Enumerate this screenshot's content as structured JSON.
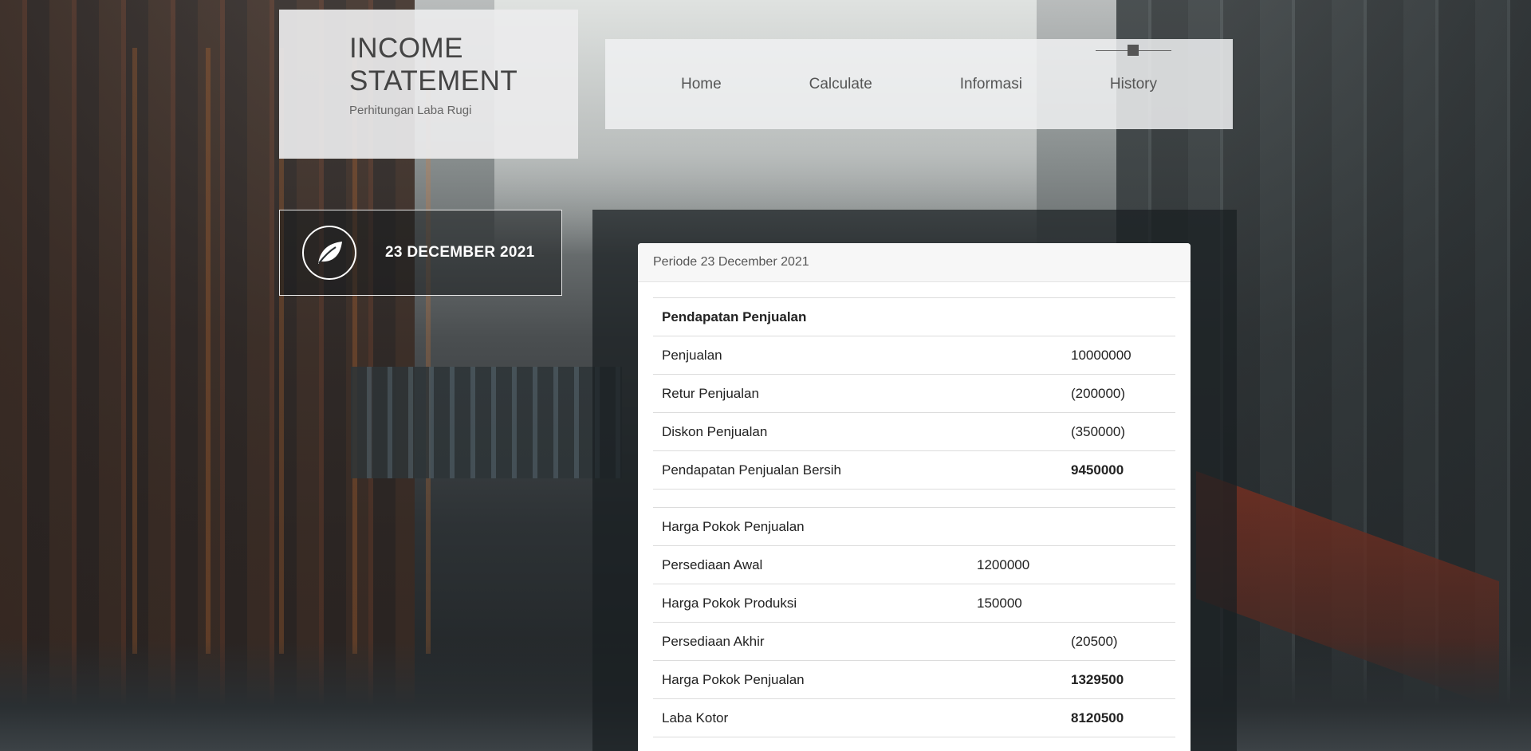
{
  "brand": {
    "title_line1": "INCOME",
    "title_line2": "STATEMENT",
    "subtitle": "Perhitungan Laba Rugi"
  },
  "nav": {
    "items": [
      "Home",
      "Calculate",
      "Informasi",
      "History"
    ],
    "active": "History"
  },
  "date_banner": {
    "icon": "leaf-icon",
    "text": "23 DECEMBER 2021"
  },
  "statement": {
    "header": "Periode 23 December 2021",
    "sales_section": {
      "title": "Pendapatan Penjualan",
      "rows": [
        {
          "label": "Penjualan",
          "col1": "",
          "col2": "10000000"
        },
        {
          "label": "Retur Penjualan",
          "col1": "",
          "col2": "(200000)"
        },
        {
          "label": "Diskon Penjualan",
          "col1": "",
          "col2": "(350000)"
        },
        {
          "label": "Pendapatan Penjualan Bersih",
          "col1": "",
          "col2": "9450000"
        }
      ]
    },
    "cogs_section": {
      "title": "Harga Pokok Penjualan",
      "rows": [
        {
          "label": "Persediaan Awal",
          "col1": "1200000",
          "col2": ""
        },
        {
          "label": "Harga Pokok Produksi",
          "col1": "150000",
          "col2": ""
        },
        {
          "label": "Persediaan Akhir",
          "col1": "",
          "col2": "(20500)"
        },
        {
          "label": "Harga Pokok Penjualan",
          "col1": "",
          "col2": "1329500"
        },
        {
          "label": "Laba Kotor",
          "col1": "",
          "col2": "8120500"
        }
      ]
    }
  },
  "colors": {
    "negative": "#d9534f",
    "highlight": "#2a83d8"
  }
}
